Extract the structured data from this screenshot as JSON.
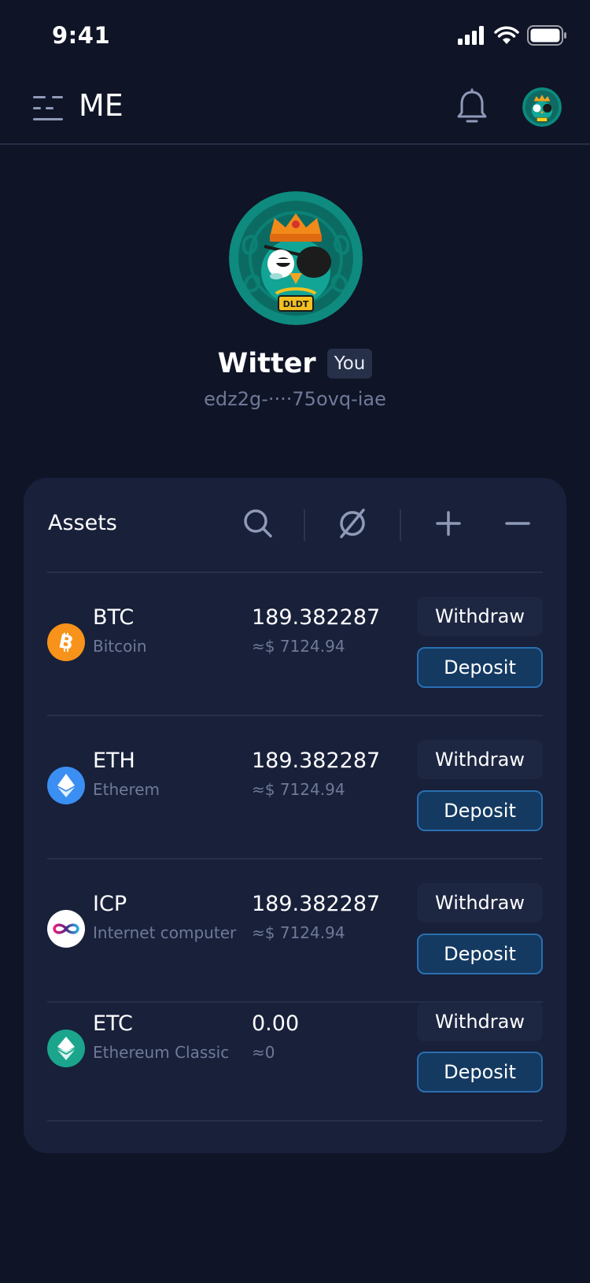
{
  "status_bar": {
    "time": "9:41"
  },
  "header": {
    "title": "ME"
  },
  "profile": {
    "name": "Witter",
    "badge": "You",
    "address": "edz2g-····75ovq-iae"
  },
  "assets": {
    "title": "Assets",
    "withdraw_label": "Withdraw",
    "deposit_label": "Deposit",
    "items": [
      {
        "symbol": "BTC",
        "name": "Bitcoin",
        "amount": "189.382287",
        "fiat": "≈$ 7124.94",
        "icon": "bitcoin-icon",
        "color": "#f7931a"
      },
      {
        "symbol": "ETH",
        "name": "Etherem",
        "amount": "189.382287",
        "fiat": "≈$ 7124.94",
        "icon": "ethereum-icon",
        "color": "#3b8ef2"
      },
      {
        "symbol": "ICP",
        "name": "Internet computer",
        "amount": "189.382287",
        "fiat": "≈$ 7124.94",
        "icon": "internet-computer-icon",
        "color": "#ffffff"
      },
      {
        "symbol": "ETC",
        "name": "Ethereum Classic",
        "amount": "0.00",
        "fiat": "≈0",
        "icon": "ethereum-classic-icon",
        "color": "#1aa58c"
      }
    ]
  },
  "avatar_badge_text": "DLDT",
  "colors": {
    "background": "#0f1427",
    "card": "#18203a",
    "deposit_bg": "#143a62",
    "deposit_border": "#2a6fb0",
    "muted_text": "#6f7a98"
  }
}
